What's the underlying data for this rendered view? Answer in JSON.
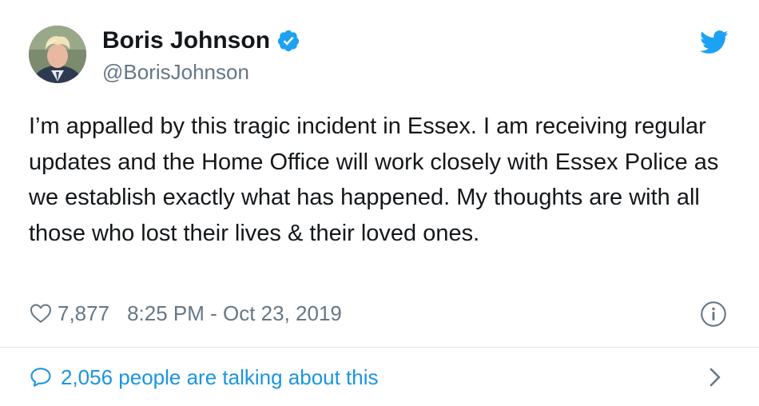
{
  "tweet": {
    "author": {
      "display_name": "Boris Johnson",
      "handle": "@BorisJohnson",
      "verified": true
    },
    "text": "I’m appalled by this tragic incident in Essex. I am receiving regular updates and the Home Office will work closely with Essex Police as we establish exactly what has happened. My thoughts are with all those who lost their lives & their loved ones.",
    "likes": "7,877",
    "timestamp": "8:25 PM - Oct 23, 2019",
    "talking_about": "2,056 people are talking about this"
  },
  "icons": {
    "verified": "verified-badge-icon",
    "brand": "twitter-bird-icon",
    "like": "heart-icon",
    "info": "info-icon",
    "conversation": "speech-bubble-icon",
    "navigate": "chevron-right-icon"
  },
  "colors": {
    "brand_blue": "#1da1f2",
    "link_blue": "#1b95e0",
    "text_primary": "#14171a",
    "text_secondary": "#657786",
    "divider": "#e1e8ed"
  }
}
